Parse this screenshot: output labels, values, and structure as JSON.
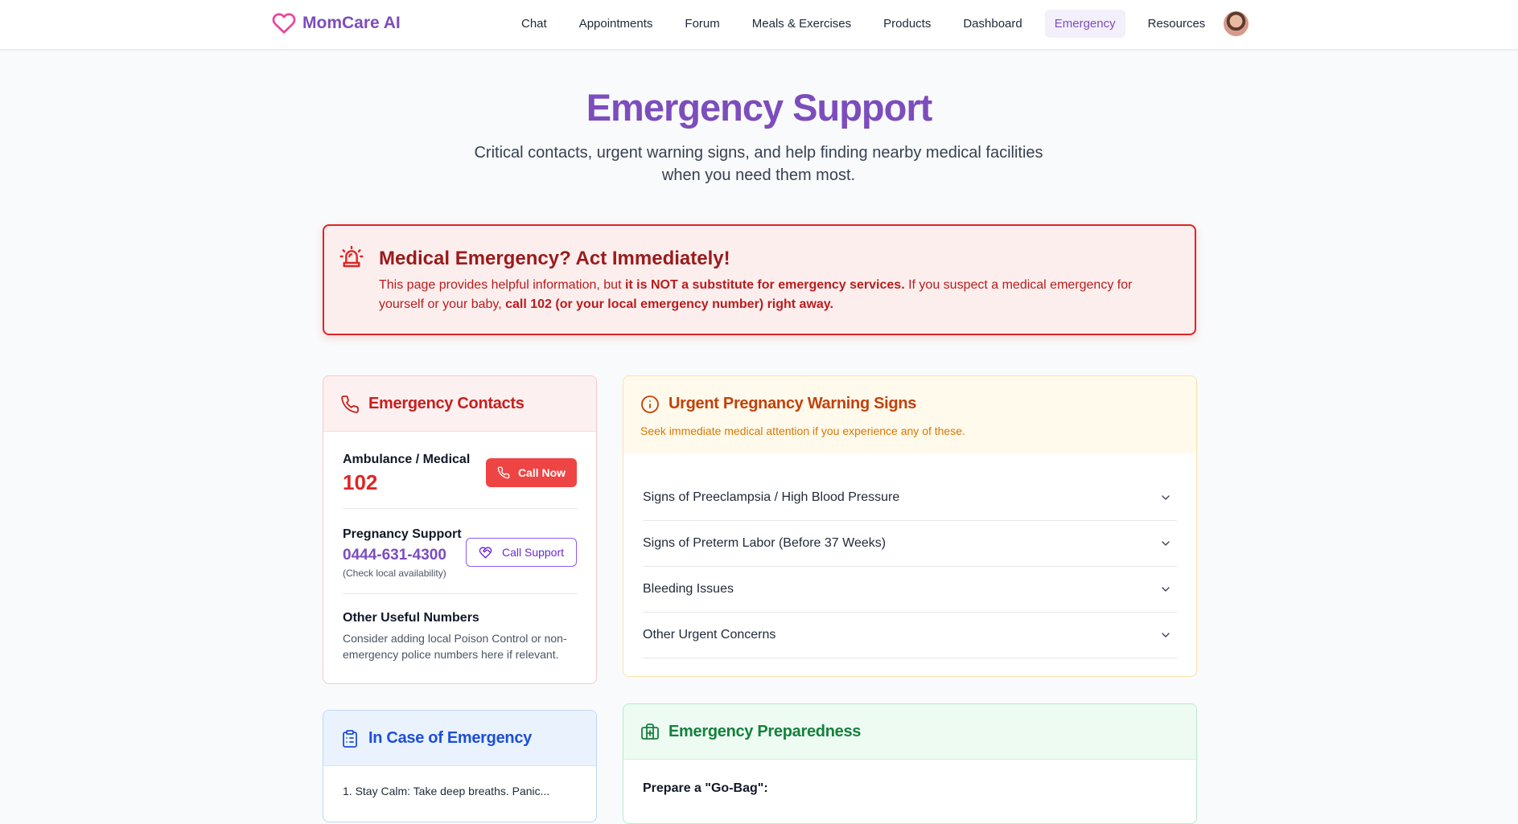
{
  "app": {
    "name": "MomCare AI"
  },
  "nav": {
    "links": [
      "Chat",
      "Appointments",
      "Forum",
      "Meals & Exercises",
      "Products",
      "Dashboard",
      "Emergency",
      "Resources"
    ],
    "active": "Emergency"
  },
  "hero": {
    "title": "Emergency Support",
    "subtitle": "Critical contacts, urgent warning signs, and help finding nearby medical facilities when you need them most."
  },
  "alert": {
    "title": "Medical Emergency? Act Immediately!",
    "body_1": "This page provides helpful information, but ",
    "body_2": "it is NOT a substitute for emergency services.",
    "body_3": " If you suspect a medical emergency for yourself or your baby, ",
    "body_4": "call 102 (or your local emergency number) right away."
  },
  "contacts": {
    "title": "Emergency Contacts",
    "ambulance": {
      "label": "Ambulance / Medical",
      "number": "102",
      "button": "Call Now"
    },
    "pregnancy": {
      "label": "Pregnancy Support",
      "number": "0444-631-4300",
      "note": "(Check local availability)",
      "button": "Call Support"
    },
    "other": {
      "label": "Other Useful Numbers",
      "desc": "Consider adding local Poison Control or non-emergency police numbers here if relevant."
    }
  },
  "warning": {
    "title": "Urgent Pregnancy Warning Signs",
    "subtitle": "Seek immediate medical attention if you experience any of these.",
    "items": [
      "Signs of Preeclampsia / High Blood Pressure",
      "Signs of Preterm Labor (Before 37 Weeks)",
      "Bleeding Issues",
      "Other Urgent Concerns"
    ]
  },
  "incase": {
    "title": "In Case of Emergency",
    "step_1": "1. Stay Calm: Take deep breaths. Panic..."
  },
  "prep": {
    "title": "Emergency Preparedness",
    "subtitle": "Prepare a \"Go-Bag\":"
  },
  "colors": {
    "brand": "#7c4dbd",
    "danger": "#dc2626",
    "warning": "#c2410c",
    "info": "#1d4ed8",
    "success": "#15803d"
  }
}
